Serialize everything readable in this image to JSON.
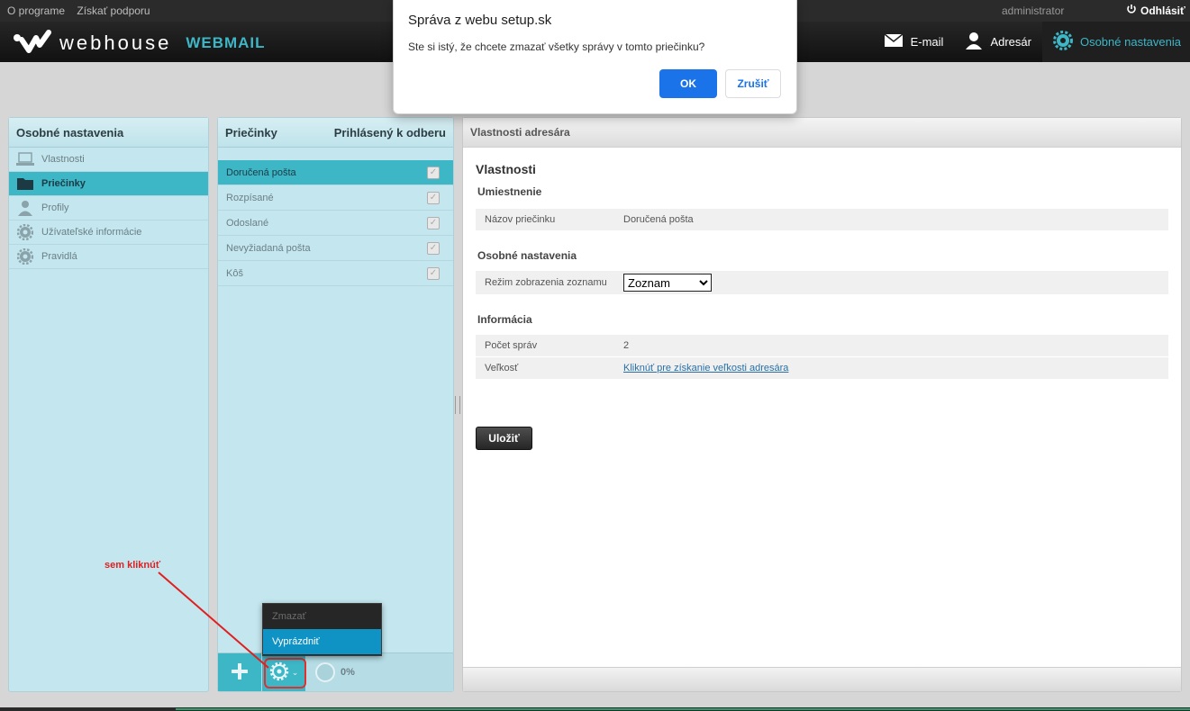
{
  "topbar": {
    "links": [
      "O programe",
      "Získať podporu"
    ],
    "user": "administrator",
    "logout_label": "Odhlásiť"
  },
  "header": {
    "logo_text": "webhouse",
    "webmail_label": "WEBMAIL",
    "nav": [
      {
        "label": "E-mail",
        "icon": "envelope-icon"
      },
      {
        "label": "Adresár",
        "icon": "person-icon"
      },
      {
        "label": "Osobné nastavenia",
        "icon": "gear-icon",
        "active": true
      }
    ]
  },
  "settings_panel": {
    "title": "Osobné nastavenia",
    "items": [
      {
        "label": "Vlastnosti",
        "icon": "laptop-icon"
      },
      {
        "label": "Priečinky",
        "icon": "folder-icon",
        "active": true
      },
      {
        "label": "Profily",
        "icon": "person-icon"
      },
      {
        "label": "Užívateľské informácie",
        "icon": "gear-icon"
      },
      {
        "label": "Pravidlá",
        "icon": "gear-icon"
      }
    ]
  },
  "folders_panel": {
    "title": "Priečinky",
    "subscribed_header": "Prihlásený k odberu",
    "folders": [
      {
        "label": "Doručená pošta",
        "active": true
      },
      {
        "label": "Rozpísané"
      },
      {
        "label": "Odoslané"
      },
      {
        "label": "Nevyžiadaná pošta"
      },
      {
        "label": "Kôš"
      }
    ],
    "quota": "0%",
    "popup_menu": [
      "Zmazať",
      "Vyprázdniť"
    ],
    "annotation": "sem kliknúť"
  },
  "props_panel": {
    "header": "Vlastnosti adresára",
    "title": "Vlastnosti",
    "section_location": "Umiestnenie",
    "folder_name_label": "Názov priečinku",
    "folder_name_value": "Doručená pošta",
    "section_settings": "Osobné nastavenia",
    "list_mode_label": "Režim zobrazenia zoznamu",
    "list_mode_value": "Zoznam",
    "section_info": "Informácia",
    "message_count_label": "Počet správ",
    "message_count_value": "2",
    "size_label": "Veľkosť",
    "size_link": "Kliknúť pre získanie veľkosti adresára",
    "save_label": "Uložiť"
  },
  "dialog": {
    "title": "Správa z webu setup.sk",
    "message": "Ste si istý, že chcete zmazať všetky správy v tomto priečinku?",
    "ok_label": "OK",
    "cancel_label": "Zrušiť"
  },
  "colors": {
    "accent": "#3db6c6",
    "dialog_button": "#1a73e8",
    "popup_selected": "#0f92c4",
    "annotation": "#e02020"
  }
}
